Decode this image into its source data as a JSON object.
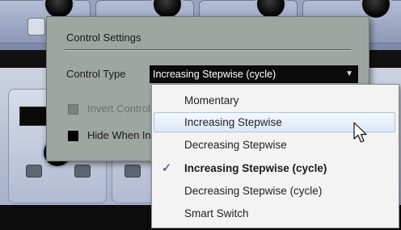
{
  "dialog": {
    "title": "Control Settings",
    "control_type_label": "Control Type",
    "control_type_value": "Increasing Stepwise (cycle)",
    "dropdown_icon": "chevron-down-icon",
    "invert_label": "Invert Control",
    "invert_checked": false,
    "invert_enabled": false,
    "hide_label": "Hide When Inactive",
    "hide_checked": true
  },
  "menu": {
    "items": [
      {
        "label": "Momentary",
        "selected": false,
        "hovered": false
      },
      {
        "label": "Increasing Stepwise",
        "selected": false,
        "hovered": true
      },
      {
        "label": "Decreasing Stepwise",
        "selected": false,
        "hovered": false
      },
      {
        "label": "Increasing Stepwise (cycle)",
        "selected": true,
        "hovered": false
      },
      {
        "label": "Decreasing Stepwise (cycle)",
        "selected": false,
        "hovered": false
      },
      {
        "label": "Smart Switch",
        "selected": false,
        "hovered": false
      }
    ],
    "check_glyph": "✓",
    "check_icon": "checkmark-icon",
    "hover_color": "#dde9f7"
  },
  "cursor": {
    "icon": "mouse-pointer-icon"
  },
  "colors": {
    "dialog_bg": "#9ea6a1",
    "select_bg": "#0b0b0b",
    "select_text": "#ffffff",
    "menu_bg": "#f3f3f3",
    "check_color": "#1b3f86"
  }
}
